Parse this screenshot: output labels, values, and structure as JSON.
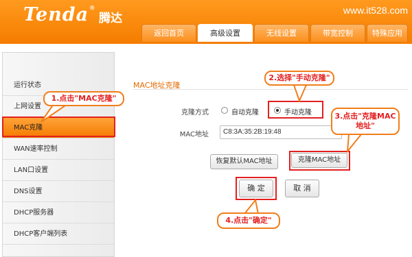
{
  "header": {
    "logo": "Tenda",
    "logo_reg": "®",
    "logo_cn": "腾达",
    "watermark": "www.it528.com"
  },
  "tabs": [
    {
      "label": "返回首页",
      "active": false
    },
    {
      "label": "高级设置",
      "active": true
    },
    {
      "label": "无线设置",
      "active": false
    },
    {
      "label": "带宽控制",
      "active": false
    },
    {
      "label": "特殊应用",
      "active": false
    }
  ],
  "sidebar": {
    "items": [
      {
        "label": "运行状态",
        "active": false
      },
      {
        "label": "上网设置",
        "active": false
      },
      {
        "label": "MAC克隆",
        "active": true
      },
      {
        "label": "WAN速率控制",
        "active": false
      },
      {
        "label": "LAN口设置",
        "active": false
      },
      {
        "label": "DNS设置",
        "active": false
      },
      {
        "label": "DHCP服务器",
        "active": false
      },
      {
        "label": "DHCP客户端列表",
        "active": false
      }
    ]
  },
  "main": {
    "section_title": "MAC地址克隆",
    "clone_mode_label": "克隆方式",
    "option_auto": "自动克隆",
    "option_manual": "手动克隆",
    "selected_option": "手动克隆",
    "mac_label": "MAC地址",
    "mac_value": "C8:3A:35:2B:19:48",
    "restore_button": "恢复默认MAC地址",
    "clone_button": "克隆MAC地址",
    "ok_button": "确 定",
    "cancel_button": "取 消"
  },
  "callouts": {
    "step1": "1.点击\"MAC克隆\"",
    "step2": "2.选择\"手动克隆\"",
    "step3_line1": "3.点击\"克隆MAC",
    "step3_line2": "地址\"",
    "step4": "4.点击\"确定\""
  },
  "colors": {
    "brand_orange": "#f57d00",
    "callout_border": "#f07e1a",
    "highlight_red": "#e31f1f"
  }
}
